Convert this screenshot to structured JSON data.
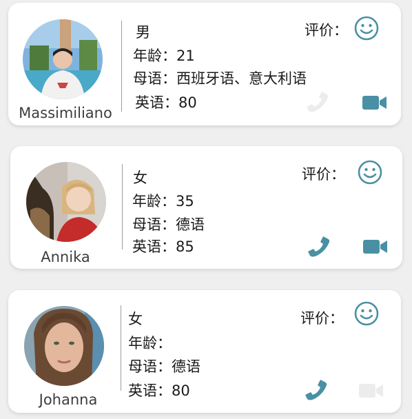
{
  "colors": {
    "accent": "#4a90a4",
    "disabled_icon": "#ececec",
    "card_background": "#ffffff",
    "page_background": "#efefef"
  },
  "tutors": [
    {
      "name": "Massimiliano",
      "gender": "男",
      "age_line": "年龄：21",
      "native_language_line": "母语：西班牙语、意大利语",
      "english_line": "英语：80",
      "rating_label": "评价：",
      "rating_icon": "smiley-icon",
      "phone_enabled": false,
      "video_enabled": true
    },
    {
      "name": "Annika",
      "gender": "女",
      "age_line": "年龄：35",
      "native_language_line": "母语：德语",
      "english_line": "英语：85",
      "rating_label": "评价：",
      "rating_icon": "smiley-icon",
      "phone_enabled": true,
      "video_enabled": true
    },
    {
      "name": "Johanna",
      "gender": "女",
      "age_line": "年龄：",
      "native_language_line": "母语：德语",
      "english_line": "英语：80",
      "rating_label": "评价：",
      "rating_icon": "smiley-icon",
      "phone_enabled": true,
      "video_enabled": false
    }
  ]
}
